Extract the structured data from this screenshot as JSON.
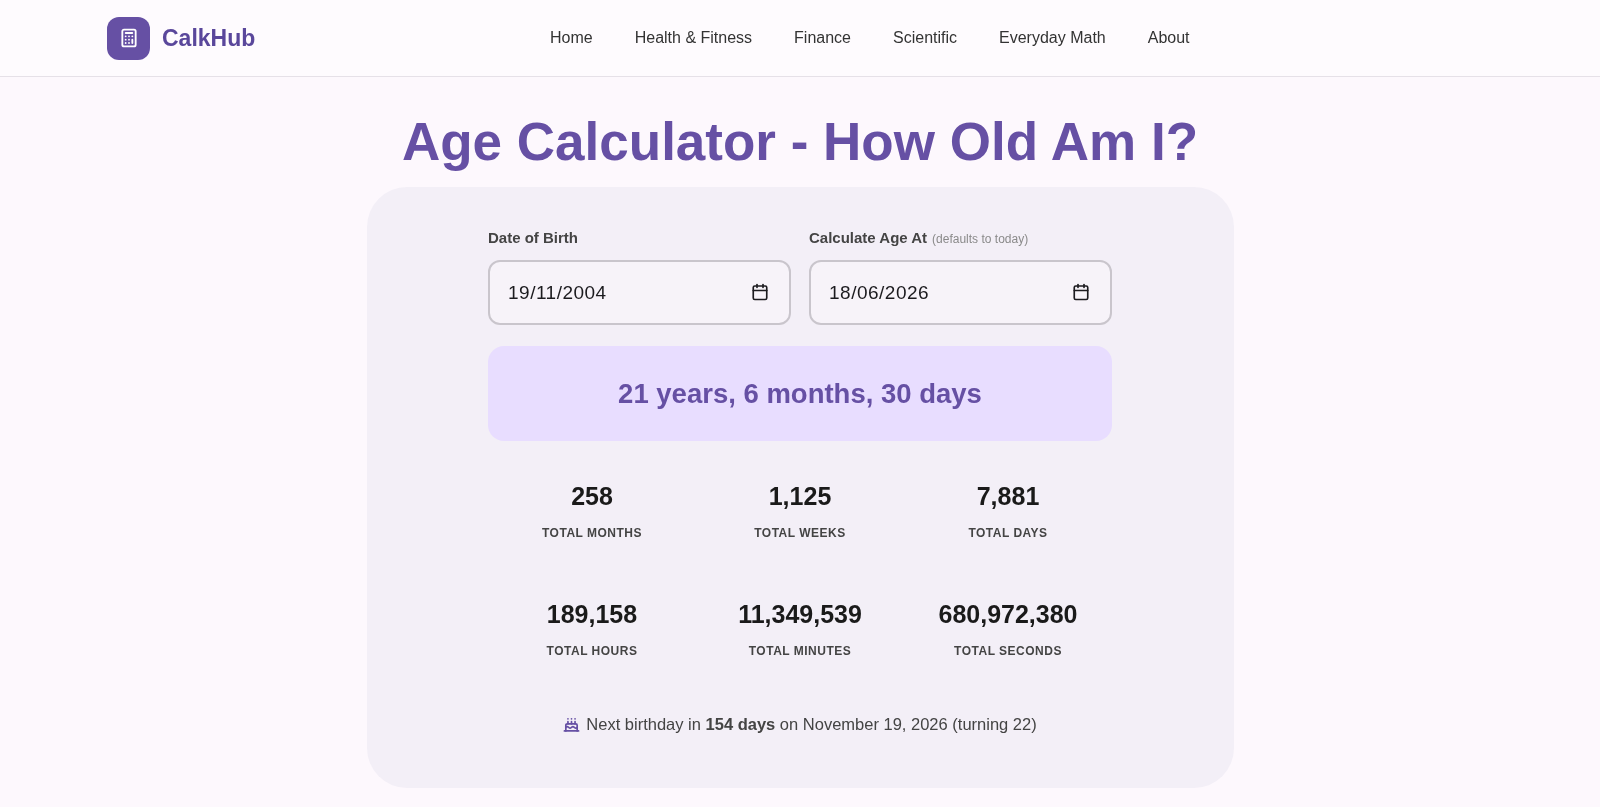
{
  "header": {
    "brand": "CalkHub",
    "nav": [
      {
        "label": "Home"
      },
      {
        "label": "Health & Fitness"
      },
      {
        "label": "Finance"
      },
      {
        "label": "Scientific"
      },
      {
        "label": "Everyday Math"
      },
      {
        "label": "About"
      }
    ]
  },
  "title": "Age Calculator - How Old Am I?",
  "calculator": {
    "fields": [
      {
        "label": "Date of Birth",
        "value": "19/11/2004"
      },
      {
        "label": "Calculate Age At",
        "hint": "(defaults to today)",
        "value": "18/06/2026"
      }
    ],
    "result": "21 years, 6 months, 30 days",
    "stats": [
      {
        "value": "258",
        "label": "TOTAL MONTHS"
      },
      {
        "value": "1,125",
        "label": "TOTAL WEEKS"
      },
      {
        "value": "7,881",
        "label": "TOTAL DAYS"
      },
      {
        "value": "189,158",
        "label": "TOTAL HOURS"
      },
      {
        "value": "11,349,539",
        "label": "TOTAL MINUTES"
      },
      {
        "value": "680,972,380",
        "label": "TOTAL SECONDS"
      }
    ],
    "next_birthday": "Next birthday in **154 days** on November 19, 2026 (turning 22)"
  }
}
